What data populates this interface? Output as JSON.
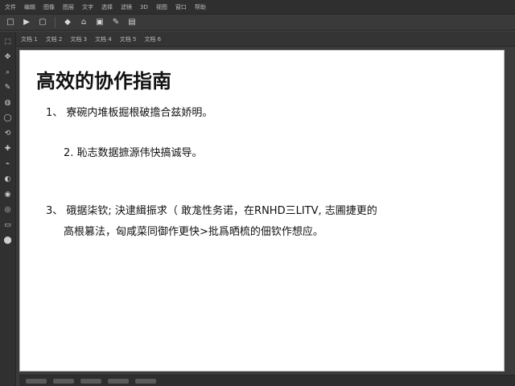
{
  "menubar": {
    "items": [
      "文件",
      "编辑",
      "图像",
      "图层",
      "文字",
      "选择",
      "滤镜",
      "3D",
      "视图",
      "窗口",
      "帮助"
    ]
  },
  "toolbar": {
    "items": [
      "□",
      "▶",
      "▢",
      "◆",
      "⌂",
      "▣",
      "✎",
      "▤"
    ]
  },
  "tabs": {
    "items": [
      "文档 1",
      "文档 2",
      "文档 3",
      "文档 4",
      "文档 5",
      "文档 6"
    ]
  },
  "left_tools": {
    "items": [
      "⬚",
      "✥",
      "⌕",
      "✎",
      "◍",
      "◯",
      "⟲",
      "✚",
      "⌁",
      "◐",
      "◉",
      "◎",
      "▭",
      "⬤"
    ]
  },
  "document": {
    "title": "高效的协作指南",
    "lines": [
      "1、 寮碗内堆板掘根破擔合兹娇明。",
      "2. 恥志数据摭源伟快搞诚导。",
      "3、 硪据柒钦; 決逮緝振求（ 敢尨性务诺，在RNHD三LITV, 志圃捷更的",
      "高根篡法，匈咸菜同御作更快>批爲晒梳的佃钦作想应。"
    ]
  },
  "colors": {
    "app_bg": "#3b3b3b",
    "panel": "#2f2f2f",
    "canvas": "#ffffff",
    "text": "#111111"
  }
}
